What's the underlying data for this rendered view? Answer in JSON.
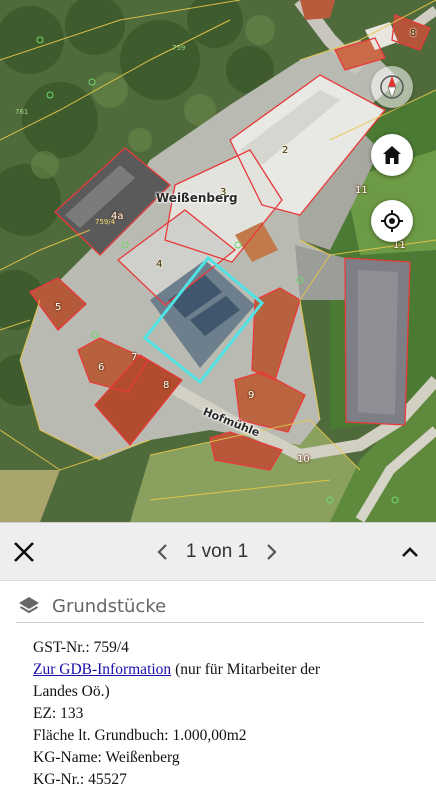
{
  "map": {
    "place_name": "Weißenberg",
    "street_name": "Hofmühle",
    "parcel_labels": [
      "8",
      "2",
      "3",
      "4a",
      "4",
      "5",
      "6",
      "7",
      "8",
      "9",
      "10",
      "11",
      "11"
    ],
    "small_labels": [
      "759/4",
      "761",
      "759"
    ],
    "buttons": {
      "compass_icon": "compass-icon",
      "home_icon": "home-icon",
      "locate_icon": "crosshair-icon"
    },
    "colors": {
      "parcel_outline": "#e83a3a",
      "selected_outline": "#4fe3e6",
      "boundary_yellow": "#e7c84a"
    }
  },
  "sheet": {
    "close_icon": "close-icon",
    "prev_icon": "chevron-left-icon",
    "next_icon": "chevron-right-icon",
    "pager_text": "1 von 1",
    "collapse_icon": "chevron-up-icon",
    "layer_icon": "layers-icon",
    "layer_title": "Grundstücke",
    "info": {
      "gst_nr": "GST-Nr.: 759/4",
      "gdb_link": "Zur GDB-Information",
      "gdb_note_1": " (nur für Mitarbeiter der",
      "gdb_note_2": "Landes Oö.)",
      "ez": "EZ: 133",
      "flaeche": "Fläche lt. Grundbuch: 1.000,00m2",
      "kg_name": "KG-Name: Weißenberg",
      "kg_nr": "KG-Nr.: 45527"
    }
  }
}
